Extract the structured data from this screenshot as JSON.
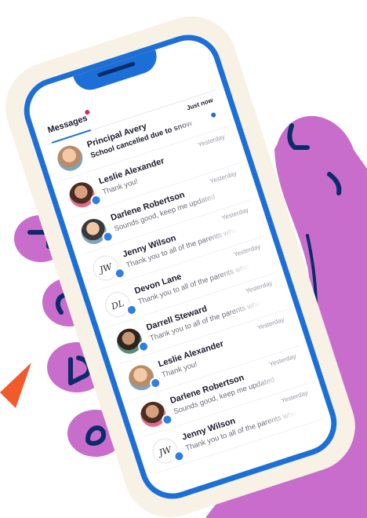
{
  "colors": {
    "phone_frame": "#1d6fd8",
    "phone_backdrop": "#f8f1e6",
    "hand": "#c86dcc",
    "hand_outline": "#0b2b6a",
    "accent_arrow": "#f15a2b",
    "unread_dot": "#1d6fd8",
    "header_dot": "#e0245e"
  },
  "header": {
    "title": "Messages"
  },
  "messages": [
    {
      "name": "Principal Avery",
      "preview": "School cancelled due to snow",
      "time": "Just now",
      "unread": true,
      "avatar": "photo",
      "initials": ""
    },
    {
      "name": "Leslie Alexander",
      "preview": "Thank you!",
      "time": "Yesterday",
      "unread": false,
      "avatar": "photo",
      "initials": ""
    },
    {
      "name": "Darlene Robertson",
      "preview": "Sounds good, keep me updated",
      "time": "Yesterday",
      "unread": false,
      "avatar": "photo",
      "initials": ""
    },
    {
      "name": "Jenny Wilson",
      "preview": "Thank you to all of the parents who",
      "time": "Yesterday",
      "unread": false,
      "avatar": "initials",
      "initials": "JW"
    },
    {
      "name": "Devon Lane",
      "preview": "Thank you to all of the parents who",
      "time": "Yesterday",
      "unread": false,
      "avatar": "initials",
      "initials": "DL"
    },
    {
      "name": "Darrell Steward",
      "preview": "Thank you to all of the parents who",
      "time": "Yesterday",
      "unread": false,
      "avatar": "photo",
      "initials": ""
    },
    {
      "name": "Leslie Alexander",
      "preview": "Thank you!",
      "time": "Yesterday",
      "unread": false,
      "avatar": "photo",
      "initials": ""
    },
    {
      "name": "Darlene Robertson",
      "preview": "Sounds good, keep me updated",
      "time": "Yesterday",
      "unread": false,
      "avatar": "photo",
      "initials": ""
    },
    {
      "name": "Jenny Wilson",
      "preview": "Thank you to all of the parents who",
      "time": "Yesterday",
      "unread": false,
      "avatar": "initials",
      "initials": "JW"
    }
  ]
}
